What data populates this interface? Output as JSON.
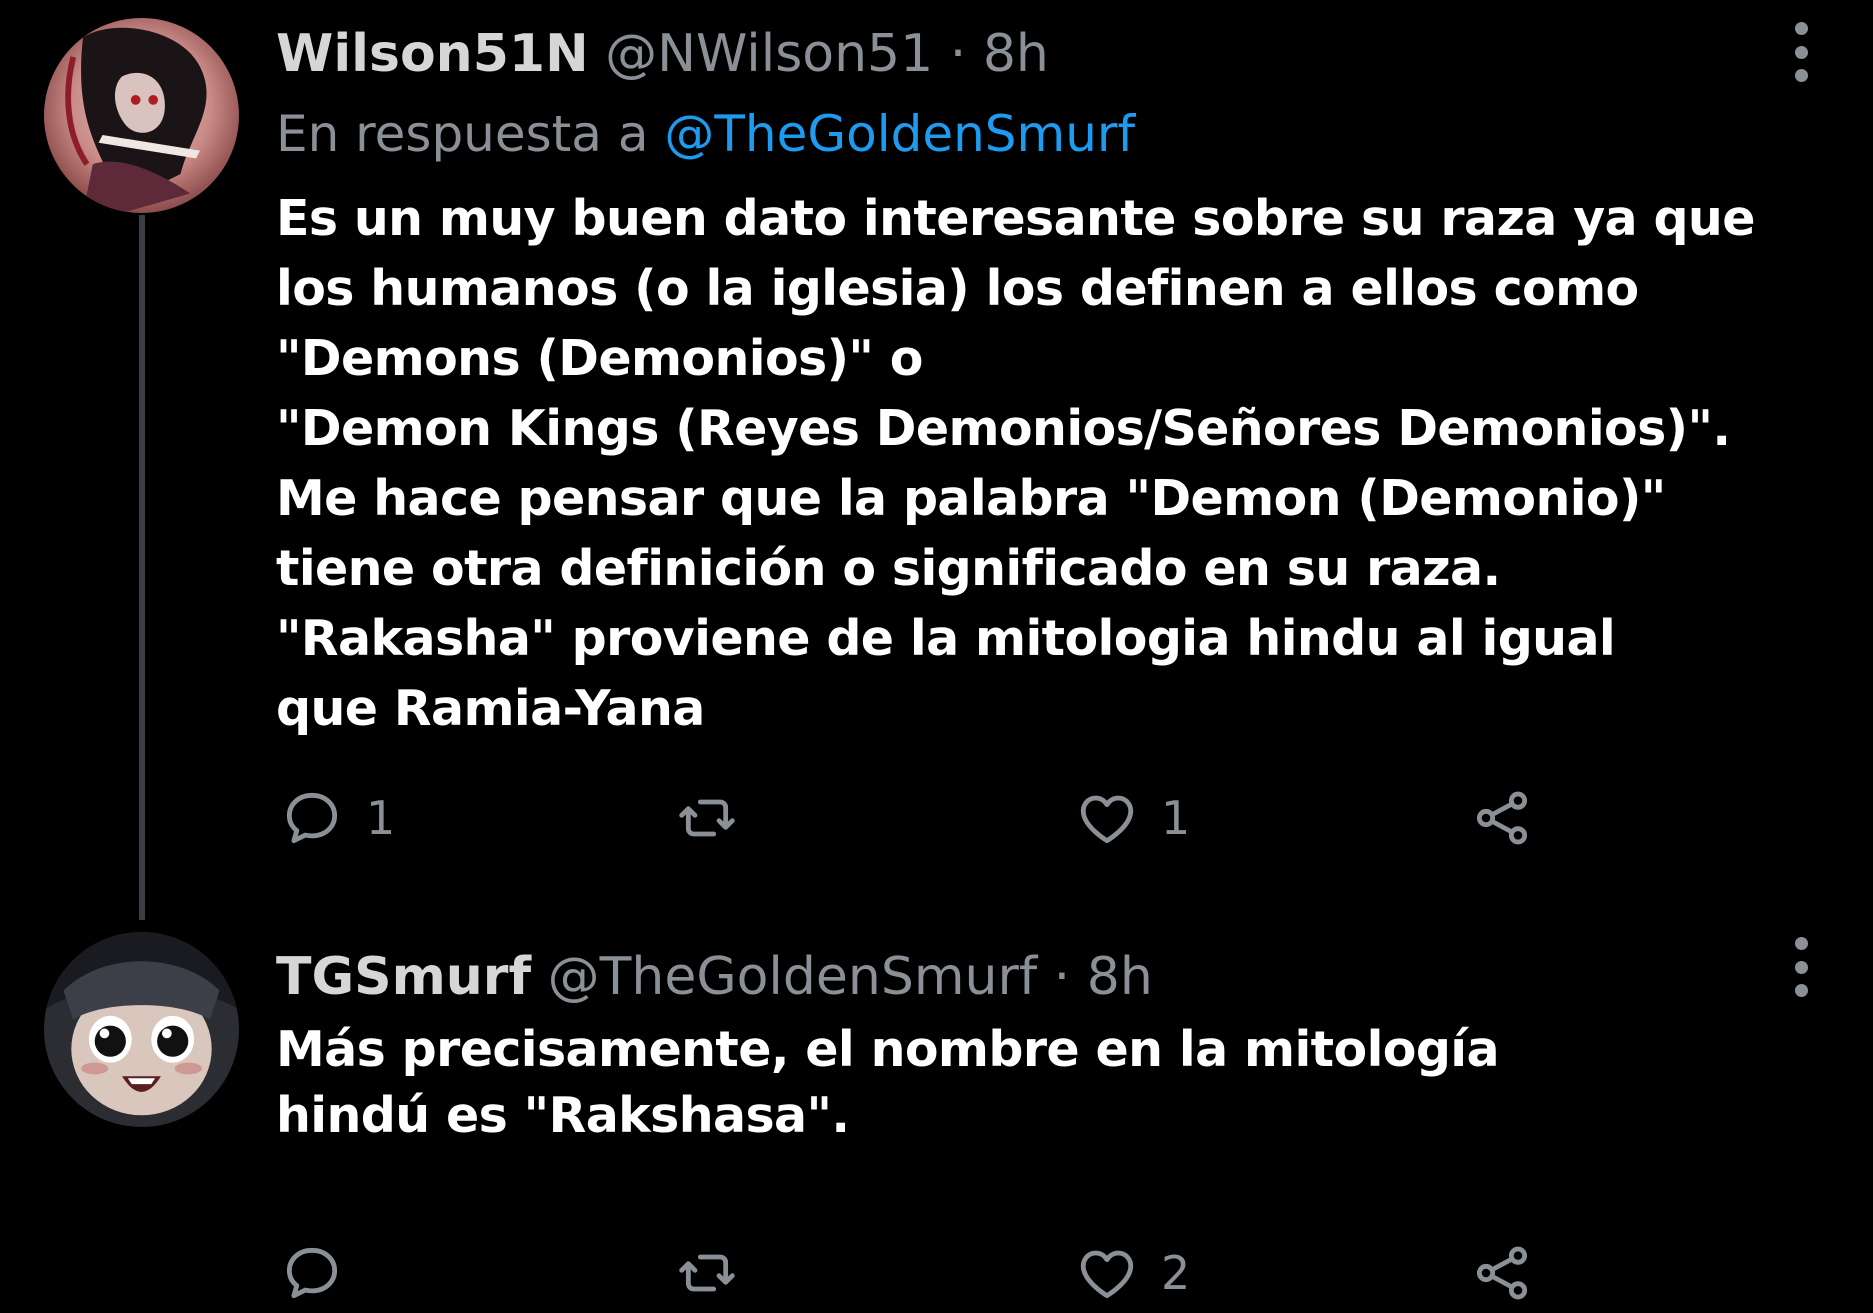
{
  "colors": {
    "background": "#000000",
    "text": "#ffffff",
    "muted": "#8b9096",
    "link": "#1d9bf0",
    "thread_line": "#3a3d41"
  },
  "tweets": [
    {
      "display_name": "Wilson51N",
      "handle": "@NWilson51",
      "separator": "·",
      "time": "8h",
      "reply_prefix": "En respuesta a",
      "reply_to": "@TheGoldenSmurf",
      "text": "Es un muy buen dato interesante sobre su raza ya que\nlos humanos (o la iglesia) los definen a ellos como\n\"Demons (Demonios)\" o\n\"Demon Kings (Reyes Demonios/Señores Demonios)\".\nMe hace pensar que la palabra \"Demon (Demonio)\"\ntiene otra definición o significado en su raza.\n\"Rakasha\" proviene de la mitologia hindu al igual\nque Ramia-Yana",
      "avatar_icon": "avatar-dark-anime-character",
      "actions": {
        "reply_count": "1",
        "retweet_count": "",
        "like_count": "1"
      }
    },
    {
      "display_name": "TGSmurf",
      "handle": "@TheGoldenSmurf",
      "separator": "·",
      "time": "8h",
      "text": "Más precisamente, el nombre en la mitología\nhindú es \"Rakshasa\".",
      "avatar_icon": "avatar-anime-face",
      "actions": {
        "reply_count": "",
        "retweet_count": "",
        "like_count": "2"
      }
    }
  ]
}
